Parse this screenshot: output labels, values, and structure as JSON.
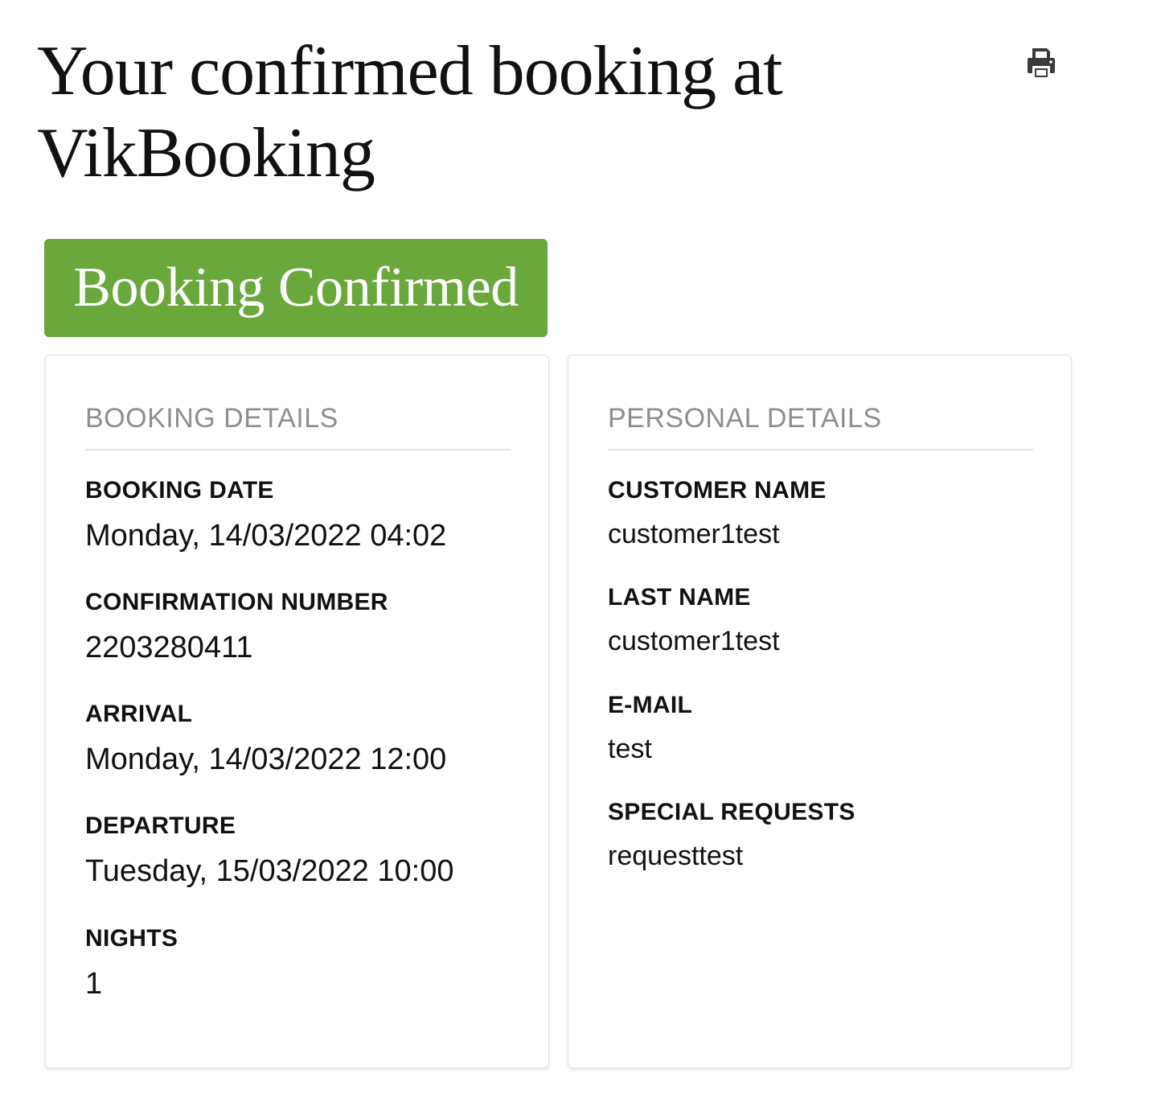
{
  "header": {
    "title": "Your confirmed booking at VikBooking",
    "print_icon": "print-icon"
  },
  "status": {
    "label": "Booking Confirmed",
    "color": "#6aa83c"
  },
  "booking_details": {
    "heading": "BOOKING DETAILS",
    "fields": [
      {
        "label": "BOOKING DATE",
        "value": "Monday, 14/03/2022 04:02"
      },
      {
        "label": "CONFIRMATION NUMBER",
        "value": "2203280411"
      },
      {
        "label": "ARRIVAL",
        "value": "Monday, 14/03/2022 12:00"
      },
      {
        "label": "DEPARTURE",
        "value": "Tuesday, 15/03/2022 10:00"
      },
      {
        "label": "NIGHTS",
        "value": "1"
      }
    ]
  },
  "personal_details": {
    "heading": "PERSONAL DETAILS",
    "fields": [
      {
        "label": "CUSTOMER NAME",
        "value": "customer1test"
      },
      {
        "label": "LAST NAME",
        "value": "customer1test"
      },
      {
        "label": "E-MAIL",
        "value": "test"
      },
      {
        "label": "SPECIAL REQUESTS",
        "value": "requesttest"
      }
    ]
  }
}
